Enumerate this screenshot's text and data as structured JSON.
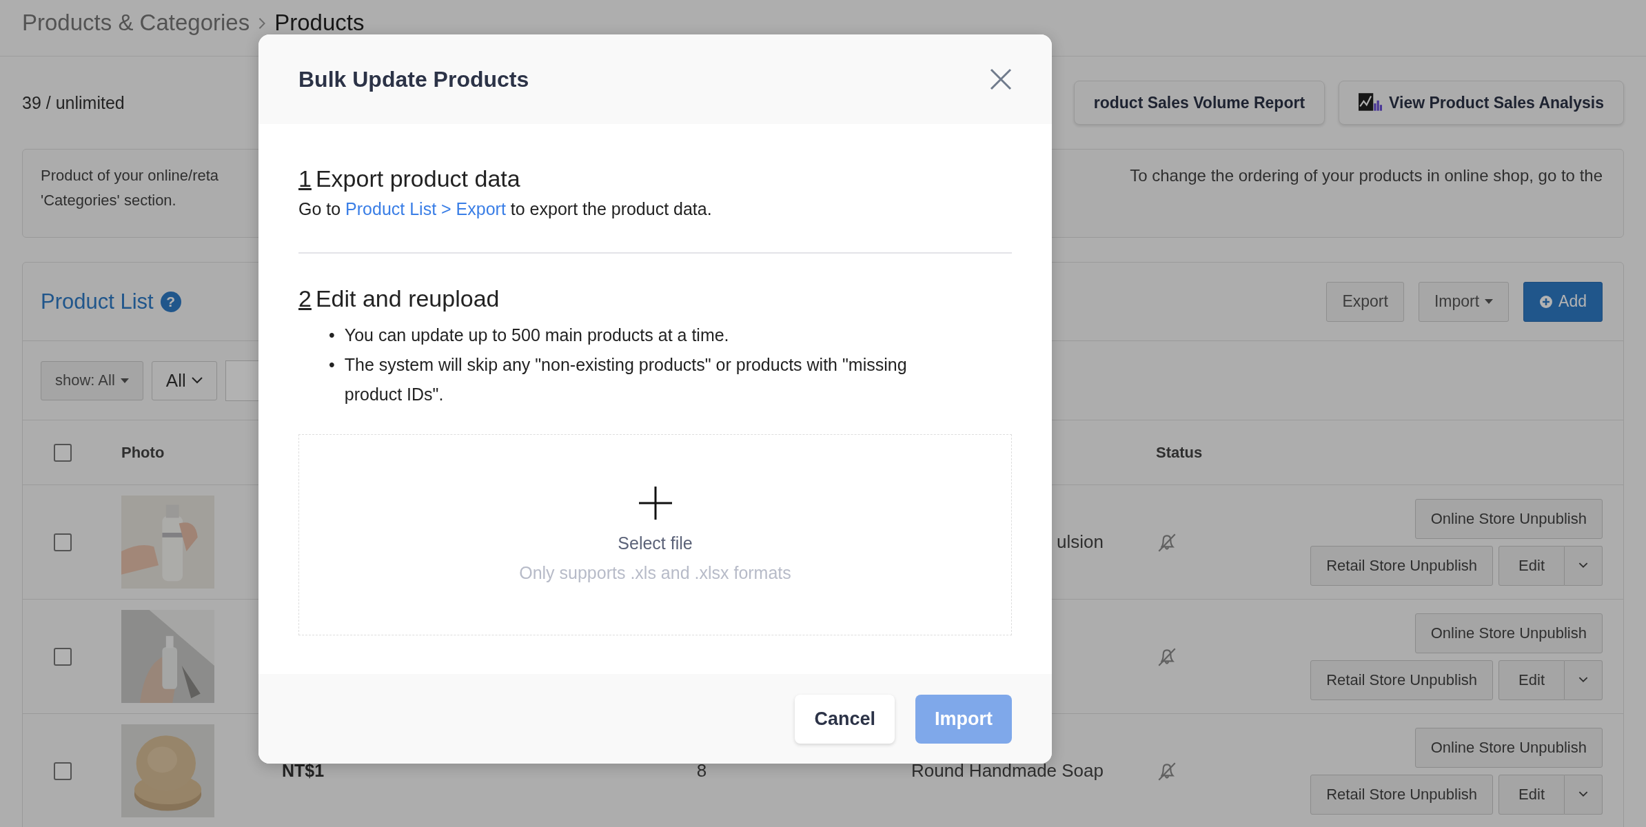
{
  "breadcrumb": [
    {
      "label": "Products & Categories",
      "current": false
    },
    {
      "label": "Products",
      "current": true
    }
  ],
  "quota": "39 / unlimited",
  "report_buttons": [
    {
      "label": "roduct Sales Volume Report",
      "kind": "plain"
    },
    {
      "label": "View Product Sales Analysis",
      "kind": "chart"
    }
  ],
  "info": {
    "left_lines": [
      "Product of your online/reta",
      "'Categories' section."
    ],
    "right_lines": [
      "To change the ordering of your products in online shop, go to the"
    ]
  },
  "product_list": {
    "title": "Product List",
    "help_mark": "?",
    "actions": [
      {
        "label": "Export",
        "kind": "default"
      },
      {
        "label": "Import",
        "kind": "dropdown"
      },
      {
        "label": "Add",
        "kind": "primary"
      }
    ],
    "filters": [
      {
        "label": "show: All",
        "kind": "caret"
      },
      {
        "label": "All",
        "kind": "chevron"
      }
    ],
    "columns": [
      "Photo",
      "Status"
    ],
    "header_checked": false,
    "rows": [
      {
        "checked": false,
        "name": "ulsion",
        "online_button": "Online Store Unpublish",
        "retail_button": "Retail Store Unpublish",
        "edit_button": "Edit"
      },
      {
        "checked": false,
        "online_button": "Online Store Unpublish",
        "retail_button": "Retail Store Unpublish",
        "edit_button": "Edit"
      },
      {
        "checked": false,
        "price": "NT$1",
        "quantity": "8",
        "name": "Round Handmade Soap",
        "online_button": "Online Store Unpublish",
        "retail_button": "Retail Store Unpublish",
        "edit_button": "Edit"
      }
    ]
  },
  "modal": {
    "title": "Bulk Update Products",
    "steps": [
      {
        "number": "1",
        "title": "Export product data"
      },
      {
        "number": "2",
        "title": "Edit and reupload"
      }
    ],
    "export_text": {
      "before": "Go to",
      "link": "Product List > Export",
      "after": "to export the product data."
    },
    "bullet_mark": "•",
    "bullets": [
      "You can update up to 500 main products at a time.",
      "The system will skip any \"non-existing products\" or products with \"missing product IDs\"."
    ],
    "upload": {
      "label": "Select file",
      "hint": "Only supports .xls and .xlsx formats"
    },
    "buttons": [
      {
        "label": "Cancel",
        "kind": "secondary",
        "disabled": false
      },
      {
        "label": "Import",
        "kind": "primary",
        "disabled": true
      }
    ]
  }
}
